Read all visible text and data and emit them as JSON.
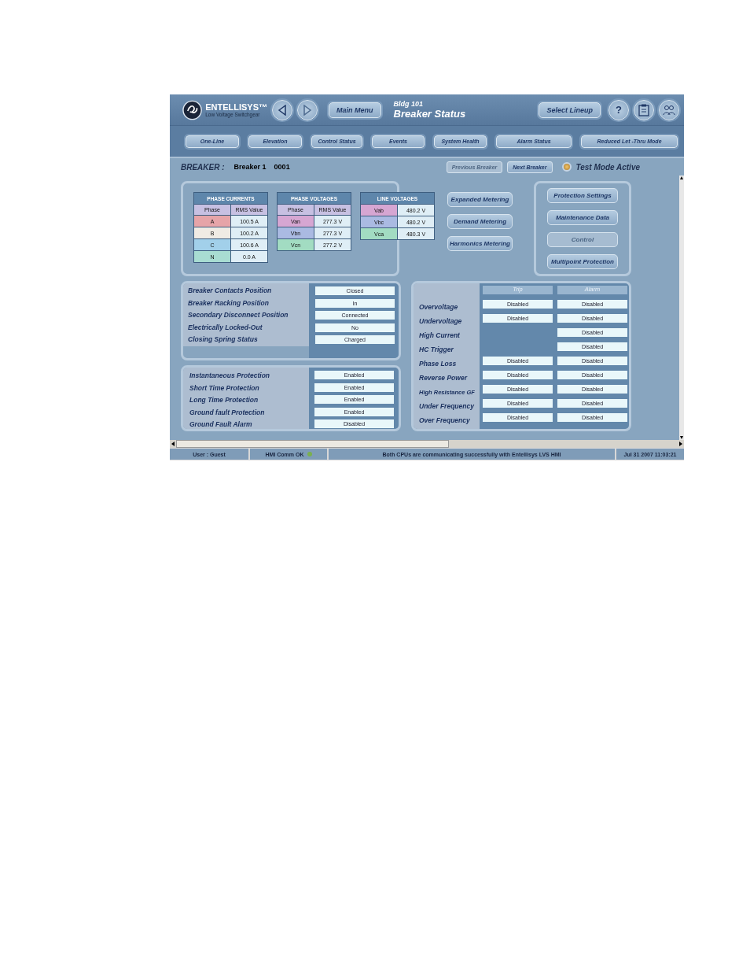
{
  "header": {
    "logo_name": "ENTELLISYS™",
    "logo_subtitle": "Low Voltage Switchgear",
    "main_menu": "Main Menu",
    "location": "Bldg 101",
    "title": "Breaker Status",
    "select_lineup": "Select Lineup",
    "help": "?"
  },
  "nav_tabs": [
    {
      "label": "One-Line"
    },
    {
      "label": "Elevation"
    },
    {
      "label": "Control Status"
    },
    {
      "label": "Events"
    },
    {
      "label": "System Health"
    },
    {
      "label": "Alarm Status"
    },
    {
      "label": "Reduced Let -Thru Mode"
    }
  ],
  "breaker": {
    "label": "BREAKER :",
    "name": "Breaker 1",
    "number": "0001"
  },
  "breaker_buttons": [
    {
      "label": "Previous Breaker",
      "disabled": true
    },
    {
      "label": "Next Breaker",
      "disabled": false
    }
  ],
  "test_mode": {
    "label": "Test Mode Active",
    "on": true
  },
  "meter_tables": [
    {
      "title": "PHASE CURRENTS",
      "columns": [
        "Phase",
        "RMS Value"
      ],
      "rows": [
        {
          "phase": "A",
          "value": "100.5 A",
          "color": "#e6a4a8"
        },
        {
          "phase": "B",
          "value": "100.2 A",
          "color": "#f0ebe4"
        },
        {
          "phase": "C",
          "value": "100.6 A",
          "color": "#a2d0ea"
        },
        {
          "phase": "N",
          "value": "0.0 A",
          "color": "#a8dcd2"
        }
      ]
    },
    {
      "title": "PHASE VOLTAGES",
      "columns": [
        "Phase",
        "RMS Value"
      ],
      "rows": [
        {
          "phase": "Van",
          "value": "277.3 V",
          "color": "#d6a6d2"
        },
        {
          "phase": "Vbn",
          "value": "277.3 V",
          "color": "#aabae2"
        },
        {
          "phase": "Vcn",
          "value": "277.2 V",
          "color": "#a2dcc2"
        }
      ]
    },
    {
      "title": "LINE VOLTAGES",
      "rows": [
        {
          "phase": "Vab",
          "value": "480.2 V",
          "color": "#d6a6d2"
        },
        {
          "phase": "Vbc",
          "value": "480.2 V",
          "color": "#aabae2"
        },
        {
          "phase": "Vca",
          "value": "480.3 V",
          "color": "#a2dcc2"
        }
      ]
    }
  ],
  "metering_buttons": [
    {
      "label": "Expanded Metering",
      "disabled": false
    },
    {
      "label": "Demand Metering",
      "disabled": false
    },
    {
      "label": "Harmonics Metering",
      "disabled": false
    }
  ],
  "action_buttons": [
    {
      "label": "Protection Settings",
      "disabled": false
    },
    {
      "label": "Maintenance Data",
      "disabled": false
    },
    {
      "label": "Control",
      "disabled": true
    },
    {
      "label": "Multipoint Protection",
      "disabled": false
    }
  ],
  "breaker_status": [
    {
      "label": "Breaker Contacts Position",
      "value": "Closed"
    },
    {
      "label": "Breaker Racking Position",
      "value": "In"
    },
    {
      "label": "Secondary Disconnect Position",
      "value": "Connected"
    },
    {
      "label": "Electrically Locked-Out",
      "value": "No"
    },
    {
      "label": "Closing Spring Status",
      "value": "Charged"
    }
  ],
  "protection_status": [
    {
      "label": "Instantaneous Protection",
      "value": "Enabled"
    },
    {
      "label": "Short Time Protection",
      "value": "Enabled"
    },
    {
      "label": "Long Time Protection",
      "value": "Enabled"
    },
    {
      "label": "Ground fault Protection",
      "value": "Enabled"
    },
    {
      "label": "Ground Fault Alarm",
      "value": "Disabled"
    }
  ],
  "trip_alarm": {
    "columns": [
      "Trip",
      "Alarm"
    ],
    "rows": [
      {
        "label": "Overvoltage",
        "trip": "Disabled",
        "alarm": "Disabled"
      },
      {
        "label": "Undervoltage",
        "trip": "Disabled",
        "alarm": "Disabled"
      },
      {
        "label": "High Current",
        "alarm": "Disabled"
      },
      {
        "label": "HC Trigger",
        "alarm": "Disabled"
      },
      {
        "label": "Phase Loss",
        "trip": "Disabled",
        "alarm": "Disabled"
      },
      {
        "label": "Reverse Power",
        "trip": "Disabled",
        "alarm": "Disabled"
      },
      {
        "label": "High Resistance GF",
        "trip": "Disabled",
        "alarm": "Disabled"
      },
      {
        "label": "Under Frequency",
        "trip": "Disabled",
        "alarm": "Disabled"
      },
      {
        "label": "Over Frequency",
        "trip": "Disabled",
        "alarm": "Disabled"
      }
    ]
  },
  "status_bar": {
    "user": "User : Guest",
    "comm": "HMI Comm OK",
    "comm_ok": true,
    "message": "Both CPUs are communicating successfully with Entellisys LVS HMI",
    "datetime": "Jul 31 2007  11:03:21"
  }
}
